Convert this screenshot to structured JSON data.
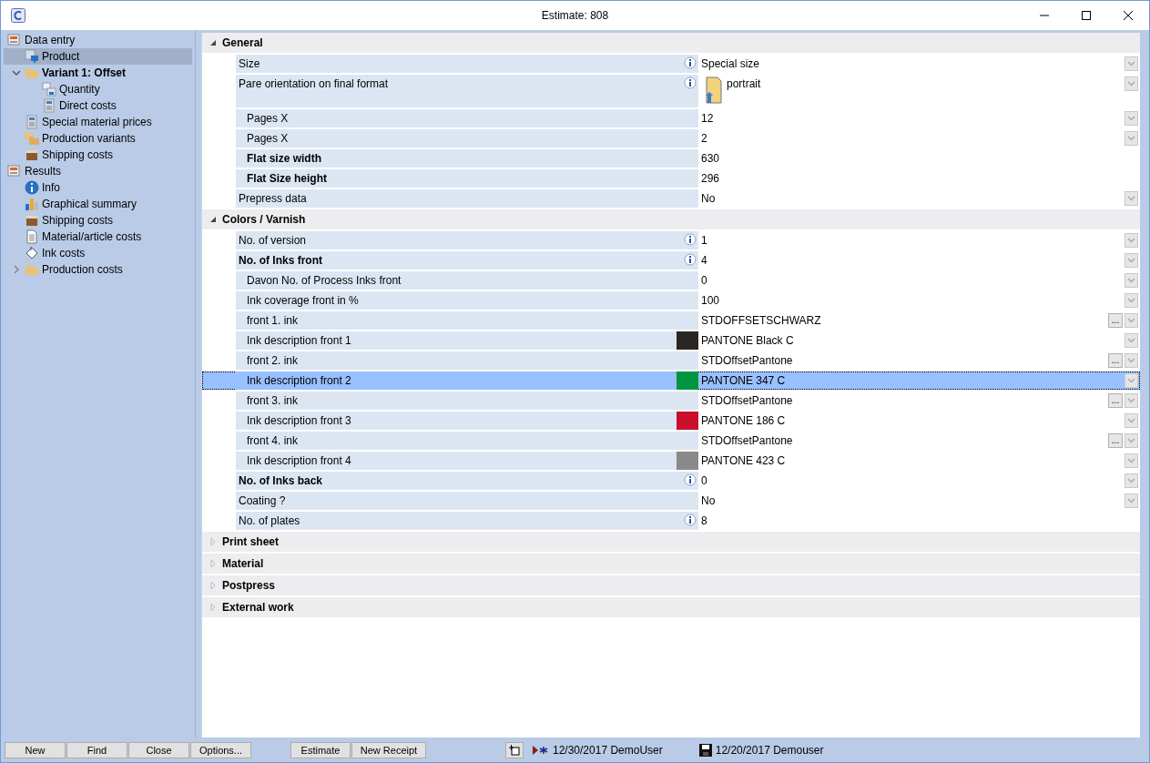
{
  "window": {
    "title": "Estimate: 808"
  },
  "tree": [
    {
      "label": "Data entry",
      "kind": "form",
      "selected": false,
      "bold": false,
      "children": [
        {
          "label": "Product",
          "kind": "product",
          "selected": true,
          "bold": false
        },
        {
          "label": "Variant 1: Offset",
          "kind": "folder",
          "selected": false,
          "bold": true,
          "expanded": true,
          "children": [
            {
              "label": "Quantity",
              "kind": "quantity",
              "selected": false,
              "bold": false
            },
            {
              "label": "Direct costs",
              "kind": "calculator",
              "selected": false,
              "bold": false
            }
          ]
        },
        {
          "label": "Special material prices",
          "kind": "calculator",
          "selected": false,
          "bold": false
        },
        {
          "label": "Production variants",
          "kind": "folders",
          "selected": false,
          "bold": false
        },
        {
          "label": "Shipping costs",
          "kind": "box",
          "selected": false,
          "bold": false
        }
      ]
    },
    {
      "label": "Results",
      "kind": "form",
      "selected": false,
      "bold": false,
      "children": [
        {
          "label": "Info",
          "kind": "info",
          "selected": false,
          "bold": false
        },
        {
          "label": "Graphical summary",
          "kind": "chart",
          "selected": false,
          "bold": false
        },
        {
          "label": "Shipping costs",
          "kind": "box",
          "selected": false,
          "bold": false
        },
        {
          "label": "Material/article costs",
          "kind": "document",
          "selected": false,
          "bold": false
        },
        {
          "label": "Ink costs",
          "kind": "ink",
          "selected": false,
          "bold": false
        },
        {
          "label": "Production costs",
          "kind": "folder",
          "selected": false,
          "bold": false,
          "expanded": false
        }
      ]
    }
  ],
  "sections": [
    {
      "title": "General",
      "expanded": true,
      "rows": [
        {
          "label": "Size",
          "kind": "main",
          "bold": false,
          "info": true,
          "value": "Special size",
          "dropdown": true,
          "selected": false
        },
        {
          "label": "Pare orientation on final format",
          "kind": "orientation",
          "bold": false,
          "info": true,
          "value": "portrait",
          "dropdown": true,
          "selected": false
        },
        {
          "label": "Pages X",
          "kind": "sub",
          "bold": false,
          "info": false,
          "value": "12",
          "dropdown": true,
          "selected": false
        },
        {
          "label": "Pages X",
          "kind": "sub",
          "bold": false,
          "info": false,
          "value": "2",
          "dropdown": true,
          "selected": false
        },
        {
          "label": "Flat size width",
          "kind": "sub",
          "bold": true,
          "info": false,
          "value": "630",
          "dropdown": false,
          "selected": false
        },
        {
          "label": "Flat Size height",
          "kind": "sub",
          "bold": true,
          "info": false,
          "value": "296",
          "dropdown": false,
          "selected": false
        },
        {
          "label": "Prepress data",
          "kind": "main",
          "bold": false,
          "info": false,
          "value": "No",
          "dropdown": true,
          "selected": false
        }
      ]
    },
    {
      "title": "Colors / Varnish",
      "expanded": true,
      "rows": [
        {
          "label": "No. of version",
          "kind": "main",
          "bold": false,
          "info": true,
          "value": "1",
          "dropdown": true,
          "selected": false
        },
        {
          "label": "No. of Inks front",
          "kind": "main",
          "bold": true,
          "info": true,
          "value": "4",
          "dropdown": true,
          "selected": false
        },
        {
          "label": "Davon No. of Process Inks front",
          "kind": "sub",
          "bold": false,
          "info": false,
          "value": "0",
          "dropdown": true,
          "selected": false
        },
        {
          "label": "Ink coverage front in %",
          "kind": "sub",
          "bold": false,
          "info": false,
          "value": "100",
          "dropdown": true,
          "selected": false
        },
        {
          "label": "front 1. ink",
          "kind": "sub",
          "bold": false,
          "info": false,
          "value": "STDOFFSETSCHWARZ",
          "browse": "...",
          "dropdown": true,
          "selected": false
        },
        {
          "label": "Ink description front 1",
          "kind": "sub",
          "bold": false,
          "info": false,
          "color": "#2b2623",
          "value": "PANTONE Black C",
          "dropdown": true,
          "selected": false
        },
        {
          "label": "front 2.  ink",
          "kind": "sub",
          "bold": false,
          "info": false,
          "value": "STDOffsetPantone",
          "browse": "...",
          "dropdown": true,
          "selected": false
        },
        {
          "label": "Ink description front 2",
          "kind": "sub",
          "bold": false,
          "info": false,
          "color": "#00963f",
          "value": "PANTONE 347 C",
          "dropdown": true,
          "selected": true
        },
        {
          "label": "front 3.  ink",
          "kind": "sub",
          "bold": false,
          "info": false,
          "value": "STDOffsetPantone",
          "browse": "...",
          "dropdown": true,
          "selected": false
        },
        {
          "label": "Ink description front 3",
          "kind": "sub",
          "bold": false,
          "info": false,
          "color": "#c8102e",
          "value": "PANTONE 186 C",
          "dropdown": true,
          "selected": false
        },
        {
          "label": "front 4.  ink",
          "kind": "sub",
          "bold": false,
          "info": false,
          "value": "STDOffsetPantone",
          "browse": "...",
          "dropdown": true,
          "selected": false
        },
        {
          "label": "Ink description front 4",
          "kind": "sub",
          "bold": false,
          "info": false,
          "color": "#898989",
          "value": "PANTONE 423 C",
          "dropdown": true,
          "selected": false
        },
        {
          "label": "No. of Inks back",
          "kind": "main",
          "bold": true,
          "info": true,
          "value": "0",
          "dropdown": true,
          "selected": false
        },
        {
          "label": "Coating ?",
          "kind": "main",
          "bold": false,
          "info": false,
          "value": "No",
          "dropdown": true,
          "selected": false
        },
        {
          "label": "No. of plates",
          "kind": "main",
          "bold": false,
          "info": true,
          "value": "8",
          "dropdown": false,
          "selected": false
        }
      ]
    },
    {
      "title": "Print sheet",
      "expanded": false
    },
    {
      "title": "Material",
      "expanded": false
    },
    {
      "title": "Postpress",
      "expanded": false
    },
    {
      "title": "External work",
      "expanded": false
    }
  ],
  "record_buttons": [
    "New",
    "Find",
    "Close",
    "Options..."
  ],
  "estimate_buttons": [
    "Estimate",
    "New Receipt"
  ],
  "status": {
    "created": "12/30/2017 DemoUser",
    "saved": "12/20/2017 Demouser"
  }
}
